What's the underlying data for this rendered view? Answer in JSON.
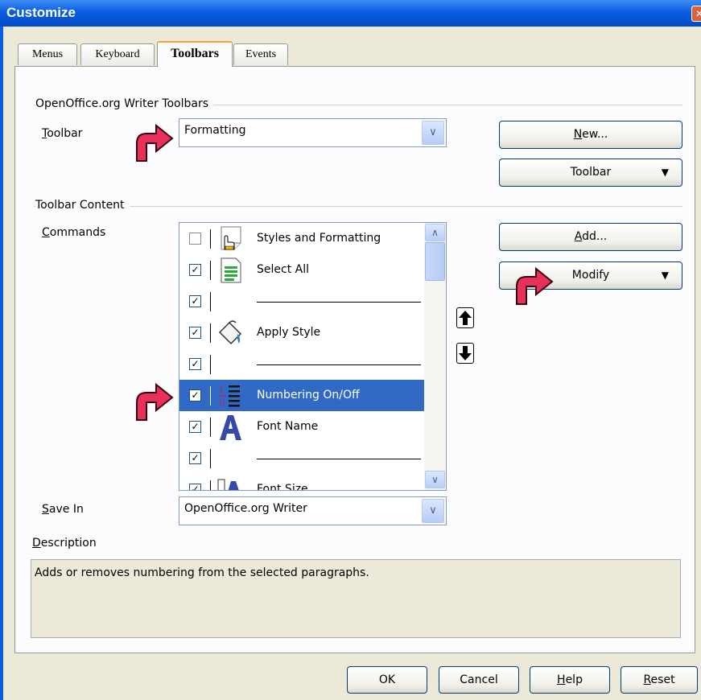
{
  "window": {
    "title": "Customize",
    "close_glyph": "✕"
  },
  "tabs": [
    {
      "label": "Menus",
      "active": false
    },
    {
      "label": "Keyboard",
      "active": false
    },
    {
      "label": "Toolbars",
      "active": true
    },
    {
      "label": "Events",
      "active": false
    }
  ],
  "toolbars_section": {
    "heading": "OpenOffice.org Writer Toolbars",
    "toolbar_label_prefix": "T",
    "toolbar_label_rest": "oolbar",
    "toolbar_value": "Formatting",
    "new_button_prefix": "N",
    "new_button_rest": "ew...",
    "toolbar_menu_button": "Toolbar"
  },
  "content_section": {
    "heading": "Toolbar Content",
    "commands_label_prefix": "C",
    "commands_label_rest": "ommands",
    "add_button_prefix": "A",
    "add_button_rest": "dd...",
    "modify_button": "Modify",
    "move_up_icon": "arrow-up-icon",
    "move_down_icon": "arrow-down-icon",
    "commands": [
      {
        "label": "Styles and Formatting",
        "checked": false,
        "icon": "styles-formatting-icon",
        "selected": false
      },
      {
        "label": "Select All",
        "checked": true,
        "icon": "select-all-icon",
        "selected": false
      },
      {
        "label": "",
        "checked": true,
        "icon": "separator",
        "selected": false
      },
      {
        "label": "Apply Style",
        "checked": true,
        "icon": "apply-style-icon",
        "selected": false
      },
      {
        "label": "",
        "checked": true,
        "icon": "separator",
        "selected": false
      },
      {
        "label": "Numbering On/Off",
        "checked": true,
        "icon": "numbering-icon",
        "selected": true
      },
      {
        "label": "Font Name",
        "checked": true,
        "icon": "font-name-icon",
        "selected": false
      },
      {
        "label": "",
        "checked": true,
        "icon": "separator",
        "selected": false
      },
      {
        "label": "Font Size",
        "checked": true,
        "icon": "font-size-icon",
        "selected": false
      }
    ]
  },
  "save_in": {
    "label_prefix": "S",
    "label_rest": "ave In",
    "value": "OpenOffice.org Writer"
  },
  "description": {
    "label_prefix": "D",
    "label_rest": "escription",
    "text": "Adds or removes numbering from the selected paragraphs."
  },
  "footer": {
    "ok": "OK",
    "cancel": "Cancel",
    "help_prefix": "H",
    "help_rest": "elp",
    "reset_prefix": "R",
    "reset_rest": "eset"
  },
  "colors": {
    "titlebar": "#0a5fe0",
    "selection": "#316ac5",
    "annotation_arrow": "#e8305a"
  }
}
